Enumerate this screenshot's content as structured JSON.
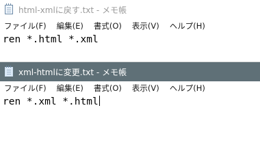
{
  "windows": [
    {
      "title": "html-xmlに戻す.txt - メモ帳",
      "menu": [
        "ファイル(F)",
        "編集(E)",
        "書式(O)",
        "表示(V)",
        "ヘルプ(H)"
      ],
      "content": "ren *.html *.xml",
      "active": false
    },
    {
      "title": "xml-htmlに変更.txt - メモ帳",
      "menu": [
        "ファイル(F)",
        "編集(E)",
        "書式(O)",
        "表示(V)",
        "ヘルプ(H)"
      ],
      "content": "ren *.xml *.html",
      "active": true
    }
  ],
  "colors": {
    "active_titlebar": "#5f7077",
    "inactive_title_text": "#9a9a9a"
  }
}
